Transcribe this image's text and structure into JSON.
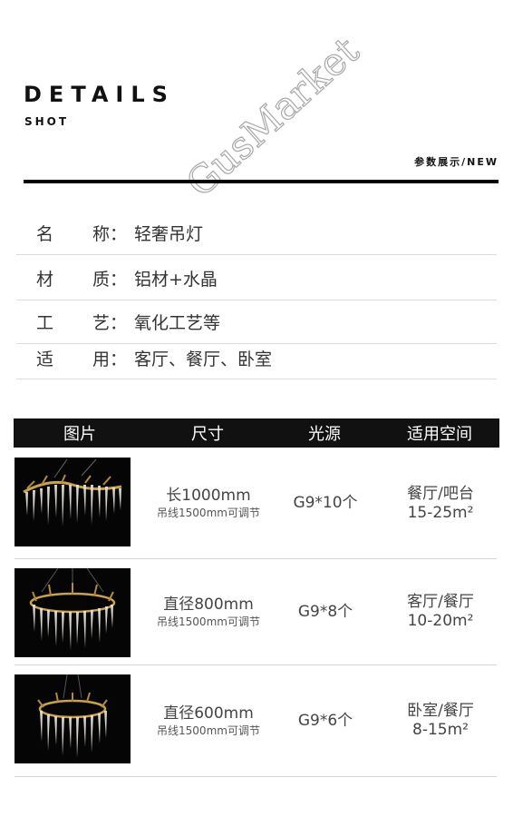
{
  "header": {
    "title": "DETAILS",
    "subtitle": "SHOT",
    "watermark": "GusMarket",
    "nav_text": "参数展示/NEW"
  },
  "specs": [
    {
      "label_first": "名",
      "label_rest": "称：",
      "value": "轻奢吊灯"
    },
    {
      "label_first": "材",
      "label_rest": "质：",
      "value": "铝材+水晶"
    },
    {
      "label_first": "工",
      "label_rest": "艺：",
      "value": "氧化工艺等"
    },
    {
      "label_first": "适",
      "label_rest": "用：",
      "value": "客厅、餐厅、卧室"
    }
  ],
  "table": {
    "headers": [
      "图片",
      "尺寸",
      "光源",
      "适用空间"
    ],
    "rows": [
      {
        "size": "长1000mm",
        "note": "吊线1500mm可调节",
        "light": "G9*10个",
        "space": "餐厅/吧台",
        "area": "15-25m²"
      },
      {
        "size": "直径800mm",
        "note": "吊线1500mm可调节",
        "light": "G9*8个",
        "space": "客厅/餐厅",
        "area": "10-20m²"
      },
      {
        "size": "直径600mm",
        "note": "吊线1500mm可调节",
        "light": "G9*6个",
        "space": "卧室/餐厅",
        "area": "8-15m²"
      }
    ]
  },
  "colors": {
    "accent": "#111111",
    "crystal": "#e8e4da",
    "gold": "#c9a24a"
  }
}
